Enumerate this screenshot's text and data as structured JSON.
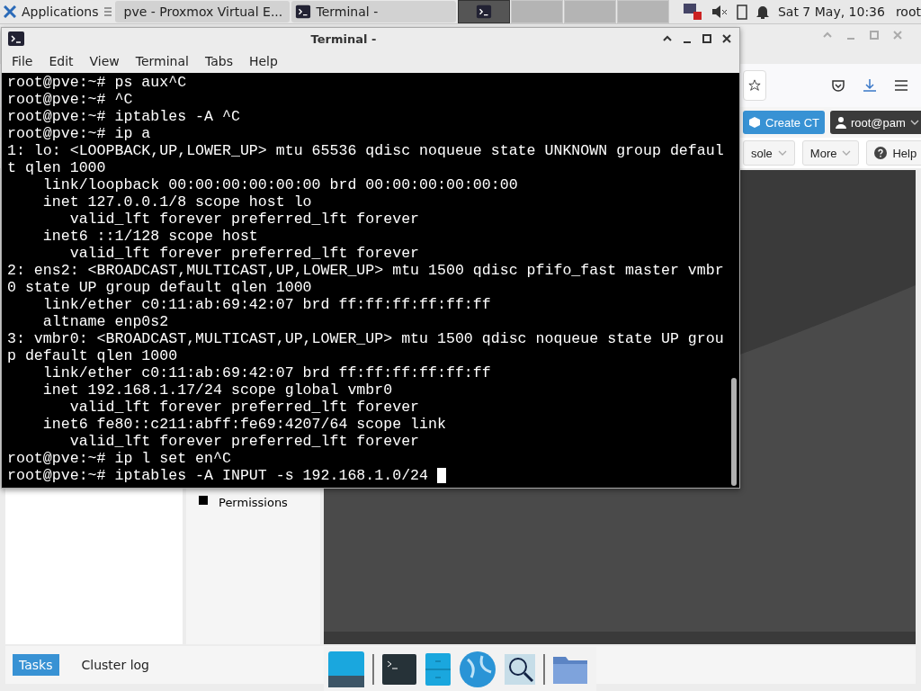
{
  "top_panel": {
    "menu_label": "Applications",
    "tasks": [
      {
        "label": "pve - Proxmox Virtual E...",
        "kind": "browser"
      },
      {
        "label": "Terminal -",
        "kind": "terminal"
      }
    ],
    "workspaces": [
      {
        "selected": true
      },
      {
        "selected": false
      },
      {
        "selected": false
      },
      {
        "selected": false
      }
    ],
    "clock": "Sat  7 May, 10:36",
    "user": "root"
  },
  "browser": {
    "header_buttons": [
      {
        "label": "Create CT",
        "kind": "primary"
      },
      {
        "label": "root@pam",
        "kind": "user"
      }
    ],
    "toolbar_buttons": [
      {
        "label": "sole",
        "kind": "split"
      },
      {
        "label": "More",
        "kind": "split"
      },
      {
        "label": "Help",
        "kind": "help"
      }
    ],
    "tree_item": "Permissions",
    "bottom_tabs": [
      {
        "label": "Tasks",
        "selected": true
      },
      {
        "label": "Cluster log",
        "selected": false
      }
    ]
  },
  "terminal": {
    "title": "Terminal -",
    "menu": [
      "File",
      "Edit",
      "View",
      "Terminal",
      "Tabs",
      "Help"
    ],
    "lines": [
      "root@pve:~# ps aux^C",
      "root@pve:~# ^C",
      "root@pve:~# iptables -A ^C",
      "root@pve:~# ip a",
      "1: lo: <LOOPBACK,UP,LOWER_UP> mtu 65536 qdisc noqueue state UNKNOWN group defaul",
      "t qlen 1000",
      "    link/loopback 00:00:00:00:00:00 brd 00:00:00:00:00:00",
      "    inet 127.0.0.1/8 scope host lo",
      "       valid_lft forever preferred_lft forever",
      "    inet6 ::1/128 scope host",
      "       valid_lft forever preferred_lft forever",
      "2: ens2: <BROADCAST,MULTICAST,UP,LOWER_UP> mtu 1500 qdisc pfifo_fast master vmbr",
      "0 state UP group default qlen 1000",
      "    link/ether c0:11:ab:69:42:07 brd ff:ff:ff:ff:ff:ff",
      "    altname enp0s2",
      "3: vmbr0: <BROADCAST,MULTICAST,UP,LOWER_UP> mtu 1500 qdisc noqueue state UP grou",
      "p default qlen 1000",
      "    link/ether c0:11:ab:69:42:07 brd ff:ff:ff:ff:ff:ff",
      "    inet 192.168.1.17/24 scope global vmbr0",
      "       valid_lft forever preferred_lft forever",
      "    inet6 fe80::c211:abff:fe69:4207/64 scope link",
      "       valid_lft forever preferred_lft forever",
      "root@pve:~# ip l set en^C",
      "root@pve:~# iptables -A INPUT -s 192.168.1.0/24 "
    ]
  }
}
